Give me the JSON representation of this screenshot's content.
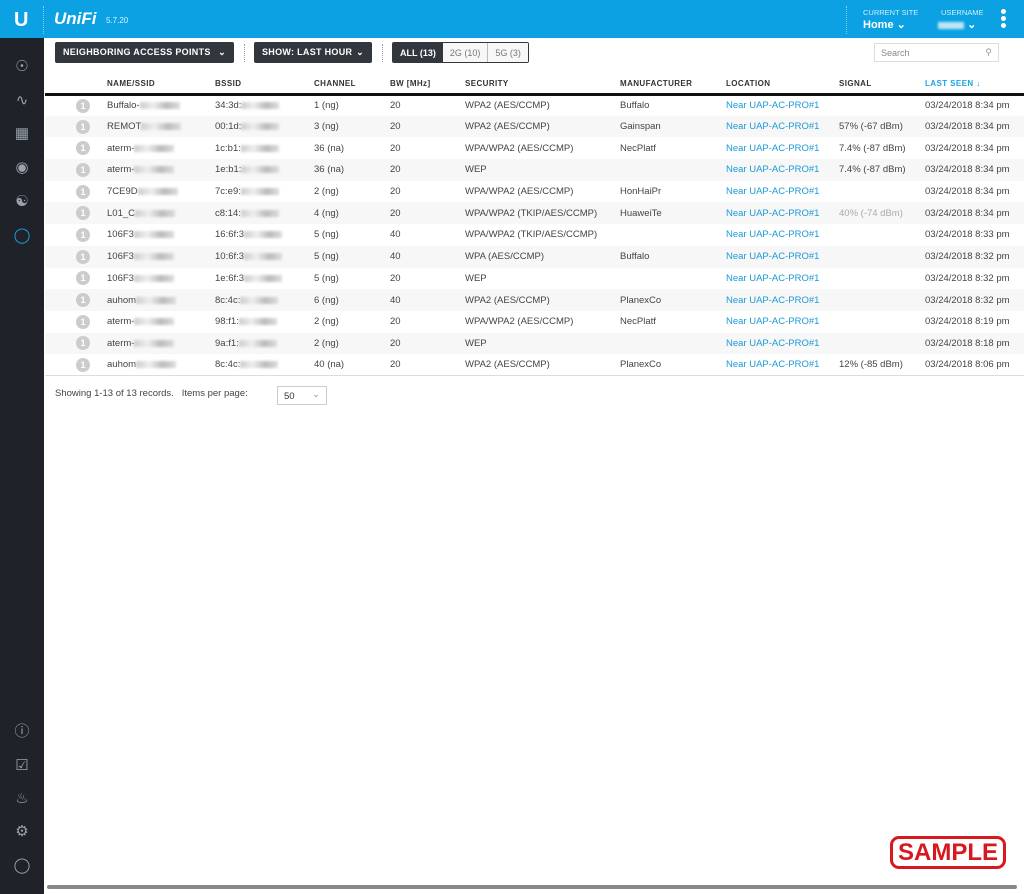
{
  "header": {
    "logo": "U",
    "brand": "UniFi",
    "version": "5.7.20",
    "site_label": "CURRENT SITE",
    "site": "Home",
    "user_label": "USERNAME"
  },
  "toolbar": {
    "view": "NEIGHBORING ACCESS POINTS",
    "show": "SHOW: LAST HOUR",
    "filters": [
      "ALL (13)",
      "2G (10)",
      "5G (3)"
    ],
    "search_placeholder": "Search"
  },
  "columns": [
    "NAME/SSID",
    "BSSID",
    "CHANNEL",
    "BW [MHz]",
    "SECURITY",
    "MANUFACTURER",
    "LOCATION",
    "SIGNAL",
    "LAST SEEN ↓"
  ],
  "rows": [
    {
      "n": "1",
      "name": "Buffalo-",
      "bssid": "34:3d:",
      "channel": "1 (ng)",
      "bw": "20",
      "security": "WPA2 (AES/CCMP)",
      "mfr": "Buffalo",
      "loc": "Near UAP-AC-PRO#1",
      "signal": "",
      "seen": "03/24/2018 8:34 pm"
    },
    {
      "n": "1",
      "name": "REMOT",
      "bssid": "00:1d:",
      "channel": "3 (ng)",
      "bw": "20",
      "security": "WPA2 (AES/CCMP)",
      "mfr": "Gainspan",
      "loc": "Near UAP-AC-PRO#1",
      "signal": "57% (-67 dBm)",
      "seen": "03/24/2018 8:34 pm"
    },
    {
      "n": "1",
      "name": "aterm-",
      "bssid": "1c:b1:",
      "channel": "36 (na)",
      "bw": "20",
      "security": "WPA/WPA2 (AES/CCMP)",
      "mfr": "NecPlatf",
      "loc": "Near UAP-AC-PRO#1",
      "signal": "7.4% (-87 dBm)",
      "seen": "03/24/2018 8:34 pm"
    },
    {
      "n": "1",
      "name": "aterm-",
      "bssid": "1e:b1:",
      "channel": "36 (na)",
      "bw": "20",
      "security": "WEP",
      "mfr": "",
      "loc": "Near UAP-AC-PRO#1",
      "signal": "7.4% (-87 dBm)",
      "seen": "03/24/2018 8:34 pm"
    },
    {
      "n": "1",
      "name": "7CE9D",
      "bssid": "7c:e9:",
      "channel": "2 (ng)",
      "bw": "20",
      "security": "WPA/WPA2 (AES/CCMP)",
      "mfr": "HonHaiPr",
      "loc": "Near UAP-AC-PRO#1",
      "signal": "",
      "seen": "03/24/2018 8:34 pm"
    },
    {
      "n": "1",
      "name": "L01_C",
      "bssid": "c8:14:",
      "channel": "4 (ng)",
      "bw": "20",
      "security": "WPA/WPA2 (TKIP/AES/CCMP)",
      "mfr": "HuaweiTe",
      "loc": "Near UAP-AC-PRO#1",
      "signal": "40% (-74 dBm)",
      "seen": "03/24/2018 8:34 pm",
      "dim": true
    },
    {
      "n": "1",
      "name": "106F3",
      "bssid": "16:6f:3",
      "channel": "5 (ng)",
      "bw": "40",
      "security": "WPA/WPA2 (TKIP/AES/CCMP)",
      "mfr": "",
      "loc": "Near UAP-AC-PRO#1",
      "signal": "",
      "seen": "03/24/2018 8:33 pm"
    },
    {
      "n": "1",
      "name": "106F3",
      "bssid": "10:6f:3",
      "channel": "5 (ng)",
      "bw": "40",
      "security": "WPA (AES/CCMP)",
      "mfr": "Buffalo",
      "loc": "Near UAP-AC-PRO#1",
      "signal": "",
      "seen": "03/24/2018 8:32 pm"
    },
    {
      "n": "1",
      "name": "106F3",
      "bssid": "1e:6f:3",
      "channel": "5 (ng)",
      "bw": "20",
      "security": "WEP",
      "mfr": "",
      "loc": "Near UAP-AC-PRO#1",
      "signal": "",
      "seen": "03/24/2018 8:32 pm"
    },
    {
      "n": "1",
      "name": "auhom",
      "bssid": "8c:4c:",
      "channel": "6 (ng)",
      "bw": "40",
      "security": "WPA2 (AES/CCMP)",
      "mfr": "PlanexCo",
      "loc": "Near UAP-AC-PRO#1",
      "signal": "",
      "seen": "03/24/2018 8:32 pm"
    },
    {
      "n": "1",
      "name": "aterm-",
      "bssid": "98:f1:",
      "channel": "2 (ng)",
      "bw": "20",
      "security": "WPA/WPA2 (AES/CCMP)",
      "mfr": "NecPlatf",
      "loc": "Near UAP-AC-PRO#1",
      "signal": "",
      "seen": "03/24/2018 8:19 pm"
    },
    {
      "n": "1",
      "name": "aterm-",
      "bssid": "9a:f1:",
      "channel": "2 (ng)",
      "bw": "20",
      "security": "WEP",
      "mfr": "",
      "loc": "Near UAP-AC-PRO#1",
      "signal": "",
      "seen": "03/24/2018 8:18 pm"
    },
    {
      "n": "1",
      "name": "auhom",
      "bssid": "8c:4c:",
      "channel": "40 (na)",
      "bw": "20",
      "security": "WPA2 (AES/CCMP)",
      "mfr": "PlanexCo",
      "loc": "Near UAP-AC-PRO#1",
      "signal": "12% (-85 dBm)",
      "seen": "03/24/2018 8:06 pm"
    }
  ],
  "footer": {
    "records": "Showing 1-13 of 13 records.",
    "per_page_label": "Items per page:",
    "per_page": "50"
  },
  "watermark": "SAMPLE"
}
